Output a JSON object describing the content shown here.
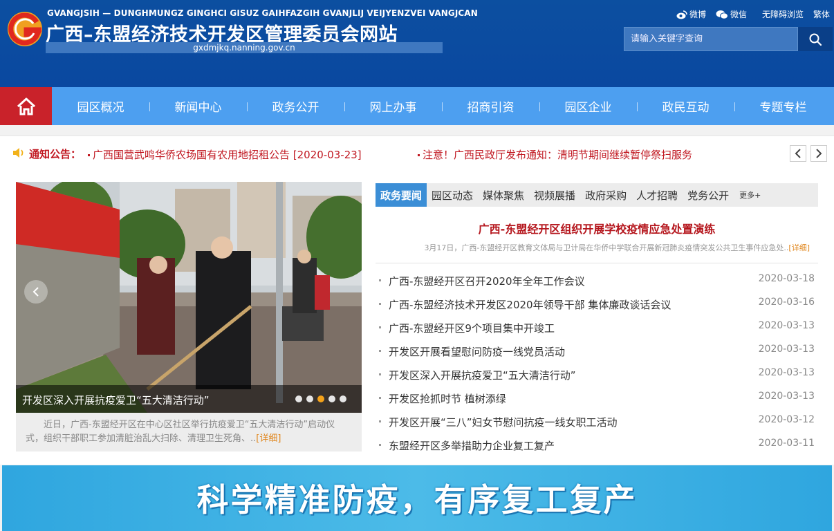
{
  "header": {
    "pinyin": "GVANGJSIH — DUNGHMUNGZ GINGHCI GISUZ GAIHFAZGIH GVANJLIJ VEIJYENZVEI VANGJCAN",
    "title": "广西–东盟经济技术开发区管理委员会网站",
    "domain": "gxdmjkq.nanning.gov.cn",
    "links": {
      "weibo": "微博",
      "weixin": "微信",
      "accessibility": "无障碍浏览",
      "traditional": "繁体"
    },
    "search_placeholder": "请输入关键字查询"
  },
  "nav": {
    "items": [
      "园区概况",
      "新闻中心",
      "政务公开",
      "网上办事",
      "招商引资",
      "园区企业",
      "政民互动",
      "专题专栏"
    ]
  },
  "notice": {
    "label": "通知公告：",
    "items": [
      "广西国营武鸣华侨农场国有农用地招租公告 [2020-03-23]",
      "注意！广西民政厅发布通知：清明节期间继续暂停祭扫服务"
    ]
  },
  "slide": {
    "caption": "开发区深入开展抗疫爱卫“五大清洁行动”",
    "summary": "近日，广西-东盟经开区在中心区社区举行抗疫爱卫“五大清洁行动”启动仪式，组织干部职工参加清脏治乱大扫除、清理卫生死角、..",
    "detail": "[详细]",
    "dots": 5,
    "active_dot": 3
  },
  "news": {
    "tabs": [
      "政务要闻",
      "园区动态",
      "媒体聚焦",
      "视频展播",
      "政府采购",
      "人才招聘",
      "党务公开",
      "更多+"
    ],
    "headline": "广西-东盟经开区组织开展学校疫情应急处置演练",
    "headline_summary": "3月17日，广西-东盟经开区教育文体局与卫计局在华侨中学联合开展新冠肺炎疫情突发公共卫生事件应急处..",
    "headline_detail": "[详细]",
    "items": [
      {
        "title": "广西-东盟经开区召开2020年全年工作会议",
        "date": "2020-03-18"
      },
      {
        "title": "广西-东盟经济技术开发区2020年领导干部 集体廉政谈话会议",
        "date": "2020-03-16"
      },
      {
        "title": "广西-东盟经开区9个项目集中开竣工",
        "date": "2020-03-13"
      },
      {
        "title": "开发区开展看望慰问防疫一线党员活动",
        "date": "2020-03-13"
      },
      {
        "title": "开发区深入开展抗疫爱卫“五大清洁行动”",
        "date": "2020-03-13"
      },
      {
        "title": "开发区抢抓时节 植树添绿",
        "date": "2020-03-13"
      },
      {
        "title": "开发区开展“三八”妇女节慰问抗疫一线女职工活动",
        "date": "2020-03-12"
      },
      {
        "title": "东盟经开区多举措助力企业复工复产",
        "date": "2020-03-11"
      }
    ]
  },
  "banner": {
    "text": "科学精准防疫，有序复工复产"
  },
  "colors": {
    "header_blue": "#0c4fa0",
    "nav_blue": "#4d9ff0",
    "home_red": "#c9222a",
    "notice_red": "#c0161f",
    "tab_active": "#3b8ed6",
    "banner": "#2fa6df"
  }
}
